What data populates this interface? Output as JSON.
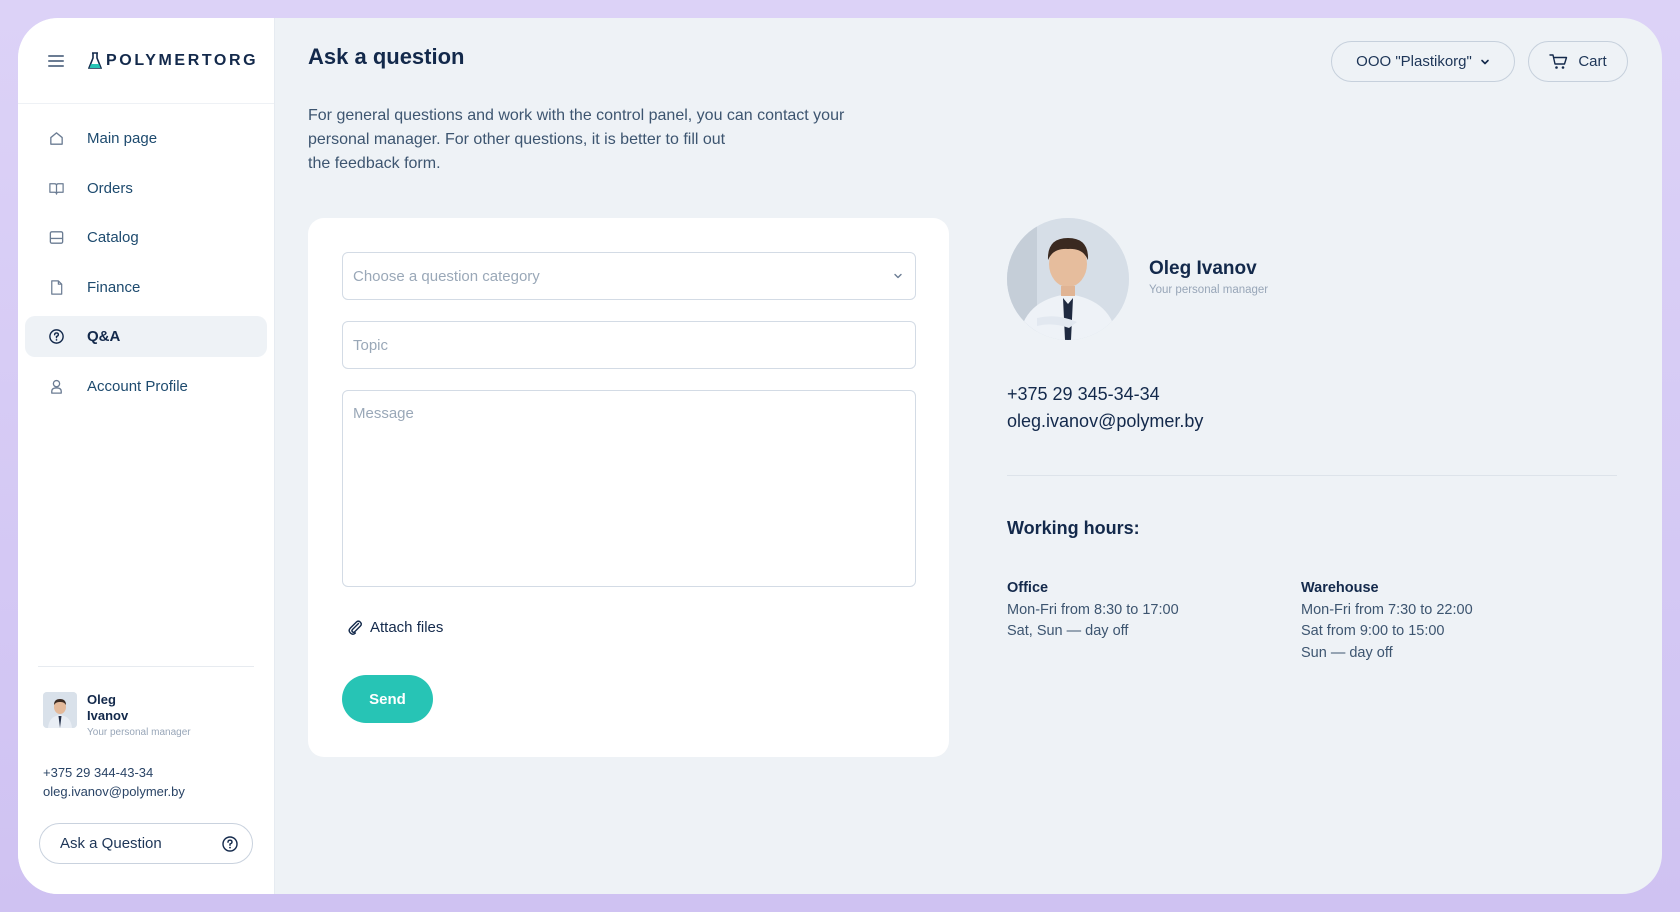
{
  "brand": {
    "name": "POLYMERTORG"
  },
  "nav": [
    {
      "label": "Main page",
      "icon": "home-icon"
    },
    {
      "label": "Orders",
      "icon": "book-icon"
    },
    {
      "label": "Catalog",
      "icon": "catalog-icon"
    },
    {
      "label": "Finance",
      "icon": "document-icon"
    },
    {
      "label": "Q&A",
      "icon": "question-circle-icon",
      "active": true
    },
    {
      "label": "Account Profile",
      "icon": "user-icon"
    }
  ],
  "sidebar_manager": {
    "first_name": "Oleg",
    "last_name": "Ivanov",
    "role": "Your personal manager",
    "phone": "+375 29 344-43-34",
    "email": "oleg.ivanov@polymer.by"
  },
  "ask_button": {
    "label": "Ask a Question"
  },
  "header": {
    "title": "Ask a question",
    "company": "OOO \"Plastikorg\"",
    "cart": "Cart"
  },
  "intro": {
    "line1": "For general questions and work with the control panel, you can contact your",
    "line2": "personal manager. For other questions, it is better to fill out",
    "line3": "the feedback form."
  },
  "form": {
    "category_placeholder": "Choose a question category",
    "topic_placeholder": "Topic",
    "message_placeholder": "Message",
    "attach_label": "Attach files",
    "send_label": "Send"
  },
  "manager": {
    "name": "Oleg Ivanov",
    "role": "Your personal manager",
    "phone": "+375 29 345-34-34",
    "email": "oleg.ivanov@polymer.by"
  },
  "hours": {
    "title": "Working hours:",
    "office": {
      "label": "Office",
      "lines": [
        "Mon-Fri from 8:30 to 17:00",
        "Sat, Sun — day off"
      ]
    },
    "warehouse": {
      "label": "Warehouse",
      "lines": [
        "Mon-Fri from 7:30 to 22:00",
        "Sat from 9:00 to 15:00",
        "Sun — day off"
      ]
    }
  },
  "colors": {
    "accent": "#27c4b5",
    "navy": "#13294b",
    "background": "#eef2f6",
    "frame": "#d9cff6"
  }
}
